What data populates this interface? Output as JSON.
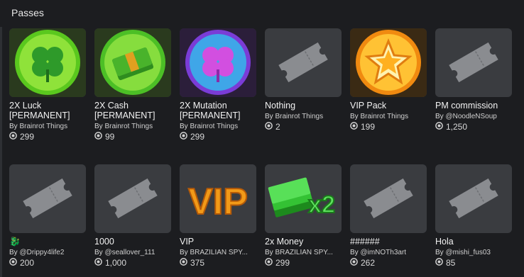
{
  "section": {
    "title": "Passes"
  },
  "by_prefix": "By",
  "colors": {
    "background": "#1c1d20",
    "card": "#3a3c40",
    "text": "#e8e8e8"
  },
  "passes": [
    {
      "name_lines": [
        "2X Luck",
        "[PERMANENT]"
      ],
      "creator": "Brainrot Things",
      "price": "299",
      "icon": "green-clover-orb-icon"
    },
    {
      "name_lines": [
        "2X Cash",
        "[PERMANENT]"
      ],
      "creator": "Brainrot Things",
      "price": "99",
      "icon": "cash-stack-orb-icon"
    },
    {
      "name_lines": [
        "2X Mutation",
        "[PERMANENT]"
      ],
      "creator": "Brainrot Things",
      "price": "299",
      "icon": "purple-clover-orb-icon"
    },
    {
      "name_lines": [
        "Nothing"
      ],
      "creator": "Brainrot Things",
      "price": "2",
      "icon": "ticket-placeholder-icon"
    },
    {
      "name_lines": [
        "VIP Pack"
      ],
      "creator": "Brainrot Things",
      "price": "199",
      "icon": "gold-star-orb-icon"
    },
    {
      "name_lines": [
        "PM commission"
      ],
      "creator": "@NoodleNSoup",
      "price": "1,250",
      "icon": "ticket-placeholder-icon"
    },
    {
      "name_lines": [
        "🐉"
      ],
      "creator": "@Drippy4life2",
      "price": "200",
      "icon": "ticket-placeholder-icon"
    },
    {
      "name_lines": [
        "1000"
      ],
      "creator": "@seallover_111",
      "price": "1,000",
      "icon": "ticket-placeholder-icon"
    },
    {
      "name_lines": [
        "VIP"
      ],
      "creator": "BRAZILIAN SPY...",
      "price": "375",
      "icon": "vip-text-icon"
    },
    {
      "name_lines": [
        "2x Money"
      ],
      "creator": "BRAZILIAN SPY...",
      "price": "299",
      "icon": "money-x2-icon"
    },
    {
      "name_lines": [
        "######"
      ],
      "creator": "@imNOTh3art",
      "price": "262",
      "icon": "ticket-placeholder-icon"
    },
    {
      "name_lines": [
        "Hola"
      ],
      "creator": "@mishi_fus03",
      "price": "85",
      "icon": "ticket-placeholder-icon"
    }
  ]
}
